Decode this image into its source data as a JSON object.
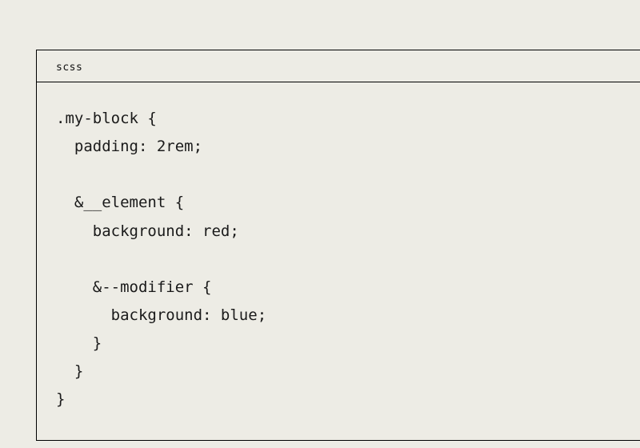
{
  "codeblock": {
    "language": "scss",
    "lines": {
      "l1": {
        "selector": ".my-block",
        "brace_open": " {"
      },
      "l2": {
        "indent": "  ",
        "prop": "padding",
        "colon": ": ",
        "value": "2rem",
        "semi": ";"
      },
      "l3": "",
      "l4": {
        "indent": "  ",
        "selector": "&__element",
        "brace_open": " {"
      },
      "l5": {
        "indent": "    ",
        "prop": "background",
        "colon": ": ",
        "value": "red",
        "semi": ";"
      },
      "l6": "",
      "l7": {
        "indent": "    ",
        "selector": "&--modifier",
        "brace_open": " {"
      },
      "l8": {
        "indent": "      ",
        "prop": "background",
        "colon": ": ",
        "value": "blue",
        "semi": ";"
      },
      "l9": {
        "indent": "    ",
        "brace_close": "}"
      },
      "l10": {
        "indent": "  ",
        "brace_close": "}"
      },
      "l11": {
        "brace_close": "}"
      }
    }
  }
}
